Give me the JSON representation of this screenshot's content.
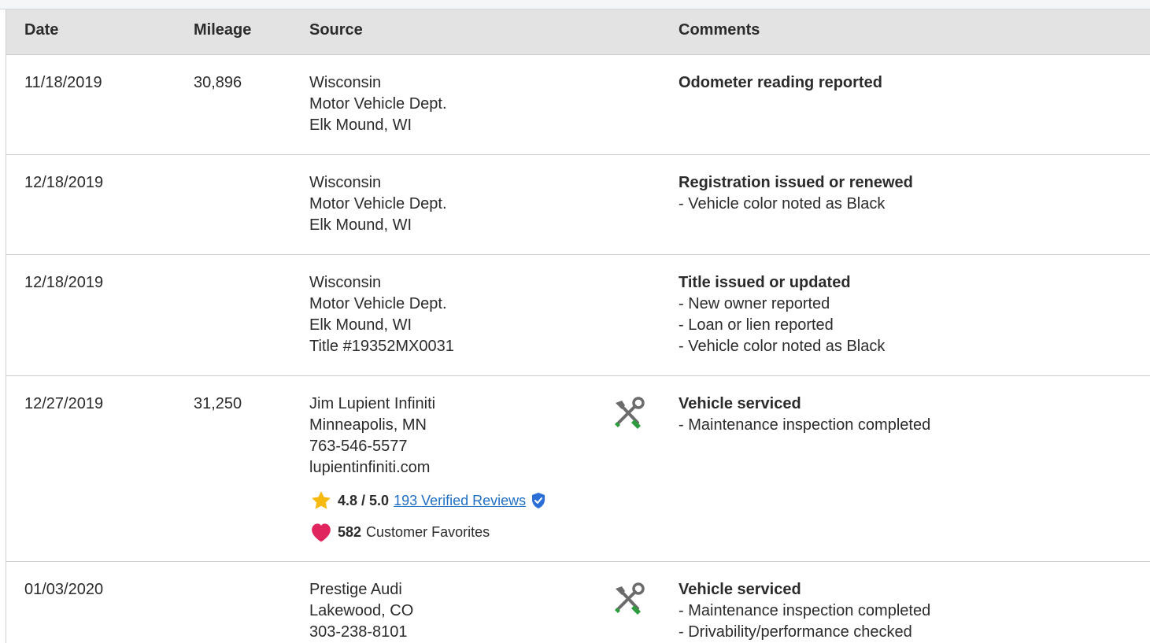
{
  "header": {
    "date": "Date",
    "mileage": "Mileage",
    "source": "Source",
    "comments": "Comments"
  },
  "rows": [
    {
      "date": "11/18/2019",
      "mileage": "30,896",
      "source": [
        "Wisconsin",
        "Motor Vehicle Dept.",
        "Elk Mound, WI"
      ],
      "comment_title": "Odometer reading reported",
      "comment_lines": []
    },
    {
      "date": "12/18/2019",
      "mileage": "",
      "source": [
        "Wisconsin",
        "Motor Vehicle Dept.",
        "Elk Mound, WI"
      ],
      "comment_title": "Registration issued or renewed",
      "comment_lines": [
        "- Vehicle color noted as Black"
      ]
    },
    {
      "date": "12/18/2019",
      "mileage": "",
      "source": [
        "Wisconsin",
        "Motor Vehicle Dept.",
        "Elk Mound, WI",
        "Title #19352MX0031"
      ],
      "comment_title": "Title issued or updated",
      "comment_lines": [
        "- New owner reported",
        "- Loan or lien reported",
        "- Vehicle color noted as Black"
      ]
    },
    {
      "date": "12/27/2019",
      "mileage": "31,250",
      "source": [
        "Jim Lupient Infiniti",
        "Minneapolis, MN",
        "763-546-5577",
        "lupientinfiniti.com"
      ],
      "rating": "4.8 / 5.0",
      "reviews_link": "193 Verified Reviews",
      "favorites_count": "582",
      "favorites_label": "Customer Favorites",
      "icon": "service-wrench-icon",
      "comment_title": "Vehicle serviced",
      "comment_lines": [
        "- Maintenance inspection completed"
      ]
    },
    {
      "date": "01/03/2020",
      "mileage": "",
      "source": [
        "Prestige Audi",
        "Lakewood, CO",
        "303-238-8101"
      ],
      "icon": "service-wrench-icon",
      "comment_title": "Vehicle serviced",
      "comment_lines": [
        "- Maintenance inspection completed",
        "- Drivability/performance checked"
      ]
    }
  ],
  "colors": {
    "header_bg": "#e3e3e3",
    "link": "#1f6fc5",
    "star": "#f5b90f",
    "heart": "#e0245e",
    "verified": "#2b6fd6",
    "wrench_gray": "#6b6b6b",
    "wrench_green": "#2e9b3e"
  }
}
